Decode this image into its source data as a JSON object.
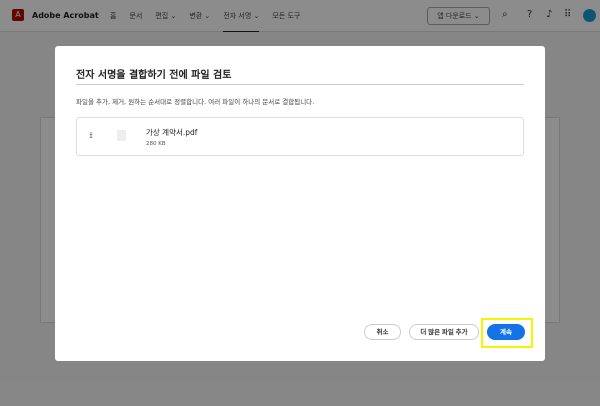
{
  "header": {
    "logo": "A",
    "app_name": "Adobe Acrobat",
    "nav": [
      "홈",
      "문서",
      "편집 ⌄",
      "변환 ⌄",
      "전자 서명 ⌄",
      "모든 도구"
    ],
    "download_label": "앱 다운로드 ⌄"
  },
  "modal": {
    "title": "전자 서명을 결합하기 전에 파일 검토",
    "description": "파일을 추가, 제거, 원하는 순서대로 정렬합니다. 여러 파일이 하나의 문서로 결합됩니다.",
    "files": [
      {
        "name": "가상 계약서.pdf",
        "size": "280 KB"
      }
    ],
    "cancel_label": "취소",
    "add_more_label": "더 많은 파일 추가",
    "continue_label": "계속"
  },
  "colors": {
    "accent": "#1473e6",
    "highlight": "#f5f500"
  }
}
